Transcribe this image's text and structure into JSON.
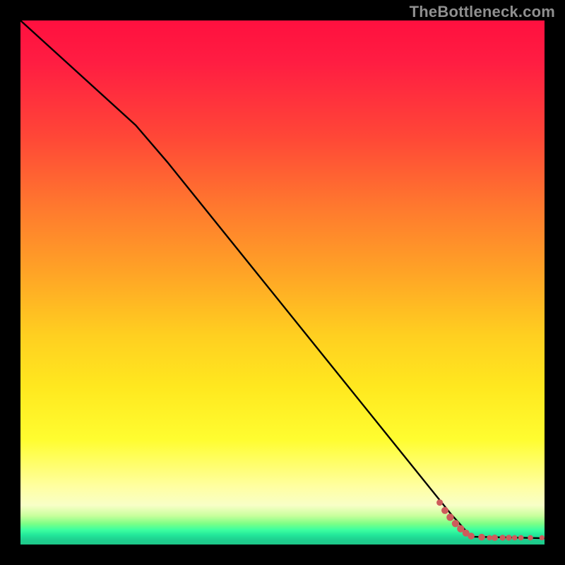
{
  "watermark": "TheBottleneck.com",
  "chart_data": {
    "type": "line",
    "title": "",
    "xlabel": "",
    "ylabel": "",
    "xlim": [
      0,
      100
    ],
    "ylim": [
      0,
      100
    ],
    "grid": false,
    "series": [
      {
        "name": "bottleneck-curve",
        "points": [
          {
            "x": 0,
            "y": 100
          },
          {
            "x": 22,
            "y": 80
          },
          {
            "x": 28,
            "y": 73
          },
          {
            "x": 82,
            "y": 6
          },
          {
            "x": 86,
            "y": 1.5
          },
          {
            "x": 100,
            "y": 1.2
          }
        ]
      }
    ],
    "scatter": {
      "name": "data-points",
      "color": "#cd5c5c",
      "points": [
        {
          "x": 80.0,
          "y": 8.0,
          "r": 4.5
        },
        {
          "x": 81.0,
          "y": 6.5,
          "r": 5.0
        },
        {
          "x": 82.0,
          "y": 5.2,
          "r": 5.2
        },
        {
          "x": 83.0,
          "y": 4.0,
          "r": 5.2
        },
        {
          "x": 84.0,
          "y": 3.0,
          "r": 5.2
        },
        {
          "x": 85.0,
          "y": 2.2,
          "r": 5.0
        },
        {
          "x": 86.0,
          "y": 1.6,
          "r": 4.8
        },
        {
          "x": 88.0,
          "y": 1.4,
          "r": 4.8
        },
        {
          "x": 89.5,
          "y": 1.3,
          "r": 3.8
        },
        {
          "x": 90.5,
          "y": 1.3,
          "r": 4.5
        },
        {
          "x": 92.0,
          "y": 1.3,
          "r": 4.2
        },
        {
          "x": 93.2,
          "y": 1.3,
          "r": 4.2
        },
        {
          "x": 94.3,
          "y": 1.3,
          "r": 3.8
        },
        {
          "x": 95.5,
          "y": 1.3,
          "r": 3.8
        },
        {
          "x": 97.3,
          "y": 1.3,
          "r": 3.8
        },
        {
          "x": 99.5,
          "y": 1.3,
          "r": 3.6
        }
      ]
    },
    "background": {
      "type": "vertical-gradient",
      "description": "red at top through orange, yellow, pale yellow to a thin green band at the bottom",
      "stops": [
        {
          "pos": 0.0,
          "color": "#ff103f"
        },
        {
          "pos": 0.35,
          "color": "#ff7a2e"
        },
        {
          "pos": 0.7,
          "color": "#ffe81f"
        },
        {
          "pos": 0.9,
          "color": "#ffffb0"
        },
        {
          "pos": 0.97,
          "color": "#3dffa0"
        },
        {
          "pos": 1.0,
          "color": "#1dc789"
        }
      ]
    }
  }
}
